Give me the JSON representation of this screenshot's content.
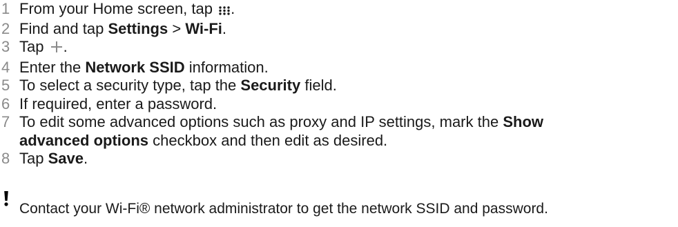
{
  "steps": [
    {
      "num": "1",
      "pre": "From your Home screen, tap ",
      "icon": "apps-grid-icon",
      "post": "."
    },
    {
      "num": "2",
      "pre": "Find and tap ",
      "b1": "Settings",
      "mid": " > ",
      "b2": "Wi-Fi",
      "post": "."
    },
    {
      "num": "3",
      "pre": "Tap ",
      "icon": "plus-icon",
      "post": "."
    },
    {
      "num": "4",
      "pre": "Enter the ",
      "b1": "Network SSID",
      "post": " information."
    },
    {
      "num": "5",
      "pre": "To select a security type, tap the ",
      "b1": "Security",
      "post": " field."
    },
    {
      "num": "6",
      "pre": "If required, enter a password."
    },
    {
      "num": "7",
      "pre": "To edit some advanced options such as proxy and IP settings, mark the ",
      "b1": "Show",
      "b2": "advanced options",
      "post": " checkbox and then edit as desired."
    },
    {
      "num": "8",
      "pre": "Tap ",
      "b1": "Save",
      "post": "."
    }
  ],
  "note": {
    "icon": "exclamation-icon",
    "text": "Contact your Wi-Fi® network administrator to get the network SSID and password."
  },
  "colors": {
    "step_number": "#8a8a8a",
    "text": "#1a1a1a",
    "plus_icon": "#8a8a8a"
  }
}
